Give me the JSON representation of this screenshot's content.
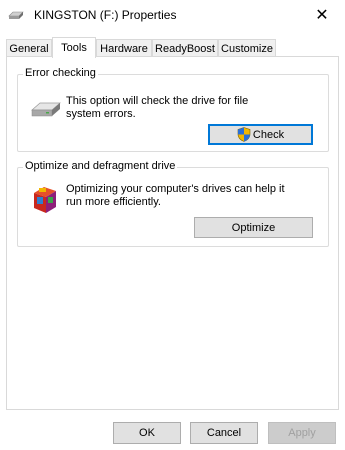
{
  "window": {
    "title": "KINGSTON (F:) Properties",
    "close_glyph": "✕"
  },
  "tabs": [
    {
      "label": "General",
      "active": false
    },
    {
      "label": "Tools",
      "active": true
    },
    {
      "label": "Hardware",
      "active": false
    },
    {
      "label": "ReadyBoost",
      "active": false
    },
    {
      "label": "Customize",
      "active": false
    }
  ],
  "error_checking": {
    "title": "Error checking",
    "description": "This option will check the drive for file system errors.",
    "button_label": "Check",
    "button_icon": "shield-icon"
  },
  "optimize": {
    "title": "Optimize and defragment drive",
    "description": "Optimizing your computer's drives can help it run more efficiently.",
    "button_label": "Optimize",
    "icon": "defrag-icon"
  },
  "footer": {
    "ok_label": "OK",
    "cancel_label": "Cancel",
    "apply_label": "Apply"
  }
}
